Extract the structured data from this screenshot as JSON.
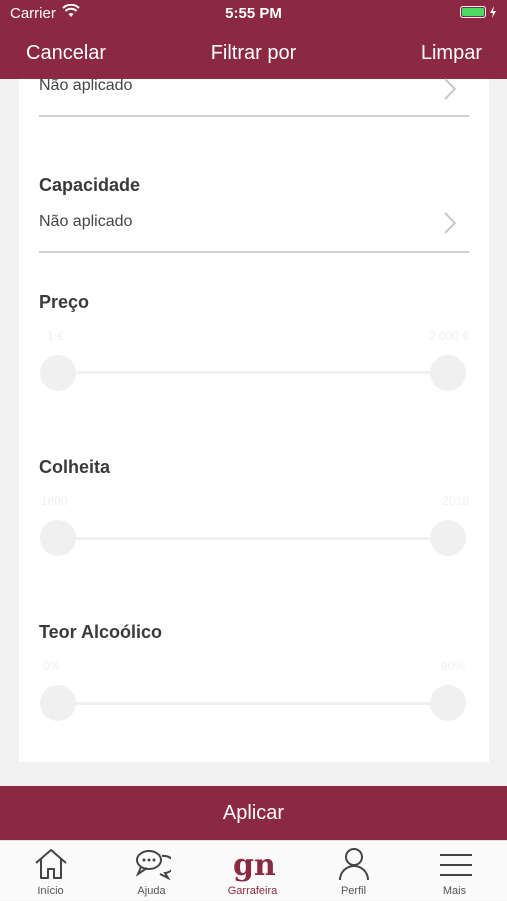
{
  "status": {
    "carrier": "Carrier",
    "time": "5:55 PM"
  },
  "nav": {
    "cancel": "Cancelar",
    "title": "Filtrar por",
    "clear": "Limpar"
  },
  "filters": {
    "first": {
      "value": "Não aplicado"
    },
    "capacity": {
      "title": "Capacidade",
      "value": "Não aplicado"
    },
    "price": {
      "title": "Preço",
      "min": "1 €",
      "max": "2 000 €"
    },
    "harvest": {
      "title": "Colheita",
      "min": "1800",
      "max": "2018"
    },
    "alcohol": {
      "title": "Teor Alcoólico",
      "min": "0%",
      "max": "90%"
    }
  },
  "apply_label": "Aplicar",
  "tabs": [
    {
      "label": "Início",
      "icon": "home-icon"
    },
    {
      "label": "Ajuda",
      "icon": "chat-icon"
    },
    {
      "label": "Garrafeira",
      "icon": "gn-logo-icon"
    },
    {
      "label": "Perfil",
      "icon": "person-icon"
    },
    {
      "label": "Mais",
      "icon": "menu-icon"
    }
  ],
  "colors": {
    "brand": "#8b2942",
    "battery": "#4cd964"
  }
}
